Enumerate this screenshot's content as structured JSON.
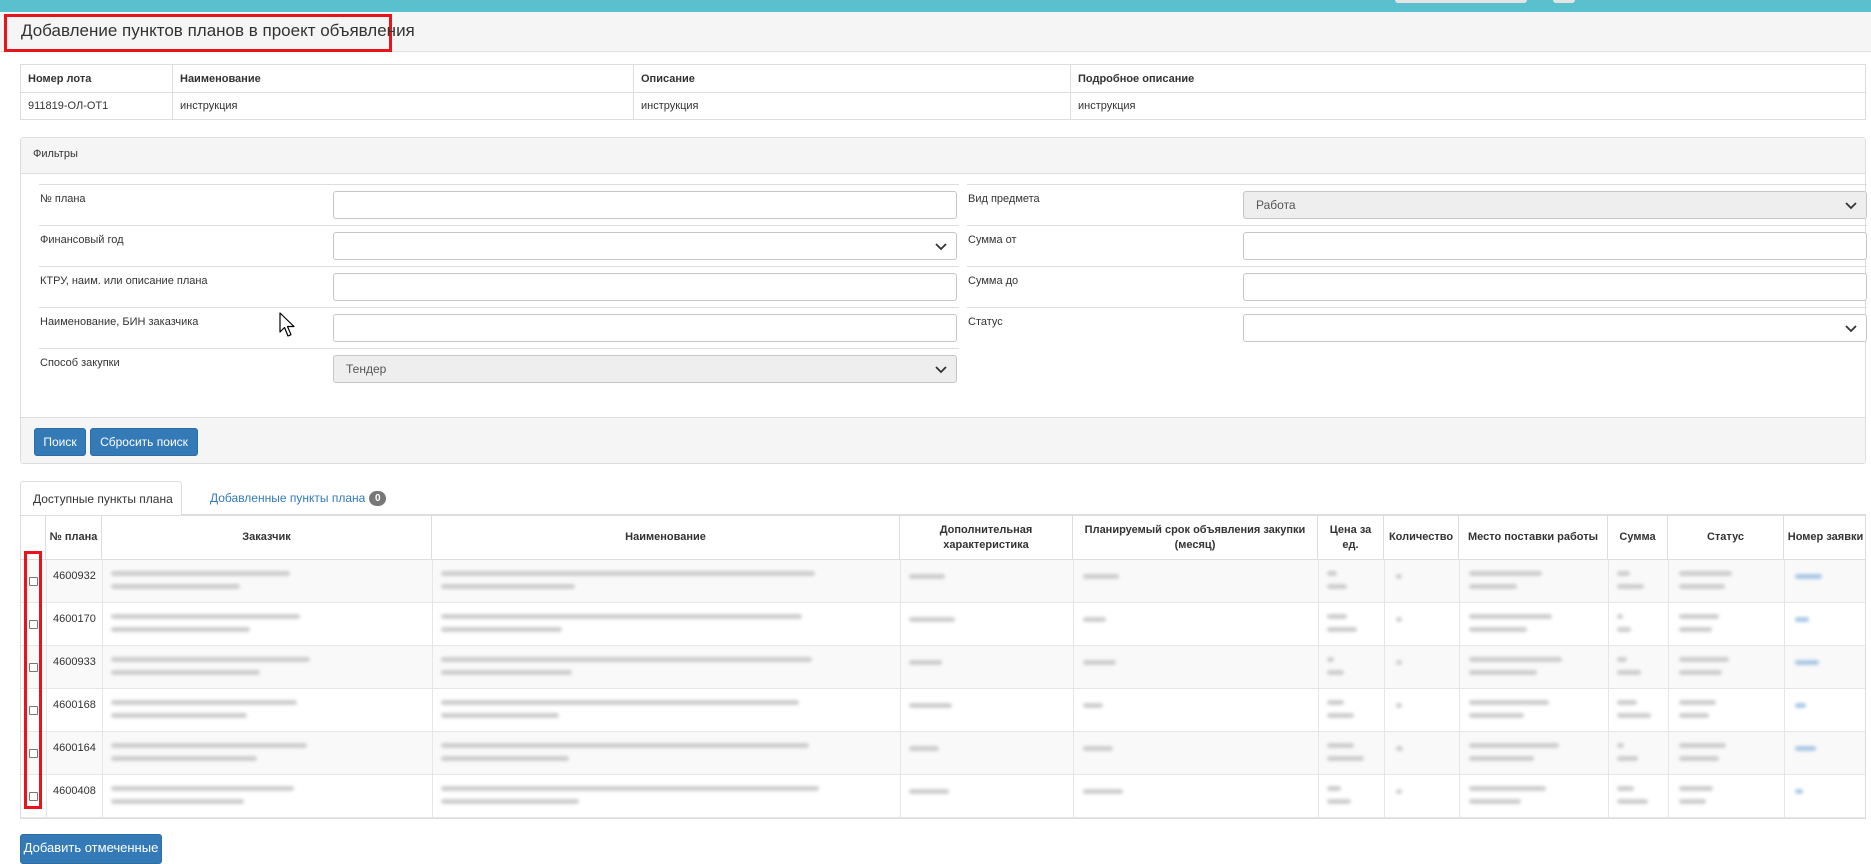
{
  "page": {
    "title": "Добавление пунктов планов в проект объявления"
  },
  "lot_table": {
    "headers": [
      "Номер лота",
      "Наименование",
      "Описание",
      "Подробное описание"
    ],
    "row": [
      "911819-ОЛ-ОТ1",
      "инструкция",
      "инструкция",
      "инструкция"
    ]
  },
  "filters": {
    "heading": "Фильтры",
    "left": [
      {
        "label": "№ плана",
        "value": ""
      },
      {
        "label": "Финансовый год",
        "value": ""
      },
      {
        "label": "КТРУ, наим. или описание плана",
        "value": ""
      },
      {
        "label": "Наименование, БИН заказчика",
        "value": ""
      },
      {
        "label": "Способ закупки",
        "value": "Тендер"
      }
    ],
    "right": [
      {
        "label": "Вид предмета",
        "value": "Работа"
      },
      {
        "label": "Сумма от",
        "value": ""
      },
      {
        "label": "Сумма до",
        "value": ""
      },
      {
        "label": "Статус",
        "value": ""
      }
    ],
    "search_button": "Поиск",
    "reset_button": "Сбросить поиск"
  },
  "tabs": {
    "available": "Доступные пункты плана",
    "added": "Добавленные пункты плана",
    "added_count": "0"
  },
  "plans_table": {
    "headers": [
      "№ плана",
      "Заказчик",
      "Наименование",
      "Дополнительная характеристика",
      "Планируемый срок объявления закупки (месяц)",
      "Цена за ед.",
      "Количество",
      "Место поставки работы",
      "Сумма",
      "Статус",
      "Номер заявки"
    ],
    "rows": [
      {
        "plan_no": "4600932"
      },
      {
        "plan_no": "4600170"
      },
      {
        "plan_no": "4600933"
      },
      {
        "plan_no": "4600168"
      },
      {
        "plan_no": "4600164"
      },
      {
        "plan_no": "4600408"
      }
    ]
  },
  "add_selected_button": "Добавить отмеченные"
}
